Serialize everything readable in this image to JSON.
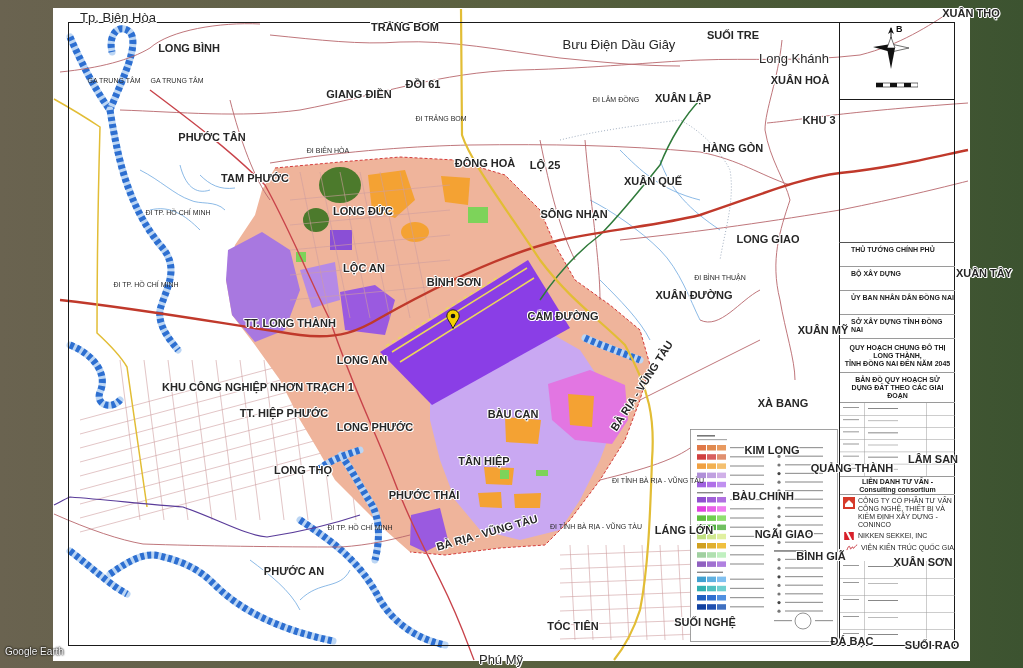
{
  "map": {
    "place_names": [
      {
        "text": "Tp. Biên Hòa",
        "kind": "city"
      },
      {
        "text": "XUÂN THỌ",
        "kind": "commune"
      },
      {
        "text": "TRẢNG BOM",
        "kind": "commune"
      },
      {
        "text": "SUỐI TRE",
        "kind": "commune"
      },
      {
        "text": "LONG BÌNH",
        "kind": "commune"
      },
      {
        "text": "Bưu Điện Dầu Giây",
        "kind": "city"
      },
      {
        "text": "Long Khánh",
        "kind": "city"
      },
      {
        "text": "ĐỒI 61",
        "kind": "commune"
      },
      {
        "text": "XUÂN HOÀ",
        "kind": "commune"
      },
      {
        "text": "GIANG ĐIỀN",
        "kind": "commune"
      },
      {
        "text": "XUÂN LẬP",
        "kind": "commune"
      },
      {
        "text": "KHU 3",
        "kind": "commune"
      },
      {
        "text": "PHƯỚC TÂN",
        "kind": "commune"
      },
      {
        "text": "HÀNG GÒN",
        "kind": "commune"
      },
      {
        "text": "ĐÔNG HOÀ",
        "kind": "commune"
      },
      {
        "text": "LỘ 25",
        "kind": "commune"
      },
      {
        "text": "TAM PHƯỚC",
        "kind": "commune"
      },
      {
        "text": "XUÂN QUẾ",
        "kind": "commune"
      },
      {
        "text": "LONG ĐỨC",
        "kind": "commune"
      },
      {
        "text": "SÔNG NHẠN",
        "kind": "commune"
      },
      {
        "text": "LONG GIAO",
        "kind": "commune"
      },
      {
        "text": "LỘC AN",
        "kind": "commune"
      },
      {
        "text": "XUÂN TÂY",
        "kind": "commune"
      },
      {
        "text": "BÌNH SƠN",
        "kind": "commune"
      },
      {
        "text": "XUÂN ĐƯỜNG",
        "kind": "commune"
      },
      {
        "text": "CẨM ĐƯỜNG",
        "kind": "commune"
      },
      {
        "text": "TT. LONG THÀNH",
        "kind": "commune"
      },
      {
        "text": "XUÂN MỸ",
        "kind": "commune"
      },
      {
        "text": "LONG AN",
        "kind": "commune"
      },
      {
        "text": "KHU CÔNG NGHIỆP NHƠN TRẠCH 1",
        "kind": "commune"
      },
      {
        "text": "TT. HIỆP PHƯỚC",
        "kind": "commune"
      },
      {
        "text": "BÀU CẠN",
        "kind": "commune"
      },
      {
        "text": "LONG PHƯỚC",
        "kind": "commune"
      },
      {
        "text": "BÀ RỊA - VŨNG TÀU",
        "kind": "road"
      },
      {
        "text": "XÀ BANG",
        "kind": "commune"
      },
      {
        "text": "KIM LONG",
        "kind": "commune"
      },
      {
        "text": "TÂN HIỆP",
        "kind": "commune"
      },
      {
        "text": "LÂM SAN",
        "kind": "commune"
      },
      {
        "text": "LONG THỌ",
        "kind": "commune"
      },
      {
        "text": "QUẢNG THÀNH",
        "kind": "commune"
      },
      {
        "text": "PHƯỚC THÁI",
        "kind": "commune"
      },
      {
        "text": "BÀU CHINH",
        "kind": "commune"
      },
      {
        "text": "BÀ RỊA - VŨNG TÀU",
        "kind": "road"
      },
      {
        "text": "LÁNG LỚN",
        "kind": "commune"
      },
      {
        "text": "NGÃI GIAO",
        "kind": "commune"
      },
      {
        "text": "BÌNH GIÃ",
        "kind": "commune"
      },
      {
        "text": "XUÂN SƠN",
        "kind": "commune"
      },
      {
        "text": "PHƯỚC AN",
        "kind": "commune"
      },
      {
        "text": "TÓC TIÊN",
        "kind": "commune"
      },
      {
        "text": "SUỐI NGHỆ",
        "kind": "commune"
      },
      {
        "text": "ĐÁ BẠC",
        "kind": "commune"
      },
      {
        "text": "SUỐI RAO",
        "kind": "commune"
      },
      {
        "text": "Phú Mỹ",
        "kind": "city"
      }
    ],
    "road_notes": [
      "GA TRUNG TÂM",
      "GA TRUNG TÂM",
      "ĐI LÂM ĐỒNG",
      "ĐI TRẢNG BOM",
      "ĐI BIÊN HÒA",
      "ĐI TP. HỒ CHÍ MINH",
      "ĐI BÌNH THUẬN",
      "ĐI TP. HỒ CHÍ MINH",
      "ĐI TỈNH BÀ RỊA - VŨNG TÀU",
      "ĐI TP. HỒ CHÍ MINH",
      "ĐI TỈNH BÀ RỊA - VŨNG TÀU"
    ],
    "compass": {
      "north_letter": "B"
    },
    "title_block": {
      "approvals": [
        "THỦ TƯỚNG CHÍNH PHỦ",
        "BỘ XÂY DỰNG",
        "ỦY BAN NHÂN DÂN ĐỒNG NAI",
        "SỞ XÂY DỰNG TỈNH ĐỒNG NAI"
      ],
      "project_title": [
        "QUY HOẠCH CHUNG ĐÔ THỊ LONG THÀNH,",
        "TỈNH ĐỒNG NAI ĐẾN NĂM 2045"
      ],
      "drawing_title": "BẢN ĐỒ QUY HOẠCH SỬ DỤNG ĐẤT THEO CÁC GIAI ĐOẠN",
      "consortium": "LIÊN DANH TƯ VẤN - Consulting consortium",
      "firms": [
        {
          "name": "CÔNG TY CỔ PHẦN TƯ VẤN CÔNG NGHỆ, THIẾT BỊ VÀ KIỂM ĐỊNH XÂY DỰNG - CONINCO",
          "kind": "house"
        },
        {
          "name": "NIKKEN SEKKEI, INC",
          "kind": "square"
        },
        {
          "name": "VIỆN KIẾN TRÚC QUỐC GIA",
          "kind": "signature"
        }
      ]
    }
  },
  "attribution": "Google Earth"
}
